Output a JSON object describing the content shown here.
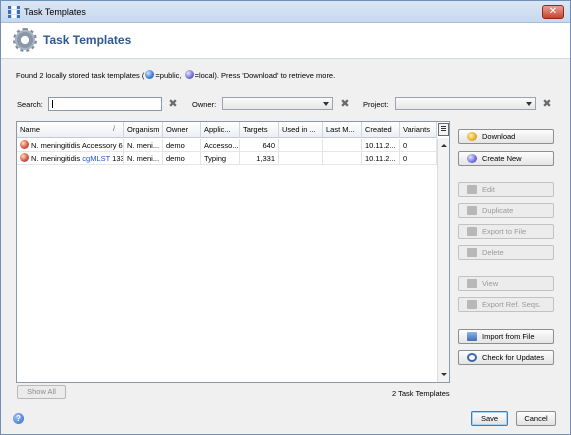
{
  "window": {
    "title": "Task Templates",
    "close_glyph": "✕"
  },
  "header": {
    "title": "Task Templates",
    "icon": "gear-icon"
  },
  "info": {
    "prefix": "Found 2 locally stored task templates (",
    "public_label": "=public, ",
    "local_label": "=local). Press 'Download' to retrieve more."
  },
  "filters": {
    "search_label": "Search:",
    "search_value": "",
    "owner_label": "Owner:",
    "owner_value": "",
    "project_label": "Project:",
    "project_value": "",
    "clear_glyph": "✖"
  },
  "table": {
    "columns": [
      "Name",
      "Organism",
      "Owner",
      "Applic...",
      "Targets",
      "Used in ...",
      "Last M...",
      "Created",
      "Variants"
    ],
    "sort_indicator": "/",
    "rows": [
      {
        "name": "N. meningitidis Accessory 6",
        "name_link": "",
        "name_suffix": "",
        "organism": "N. meni...",
        "owner": "demo",
        "application": "Accesso...",
        "targets": "640",
        "used_in": "",
        "last_modified": "",
        "created": "10.11.2...",
        "variants": "0"
      },
      {
        "name": "N. meningitidis ",
        "name_link": "cgMLST",
        "name_suffix": " 133",
        "organism": "N. meni...",
        "owner": "demo",
        "application": "Typing",
        "targets": "1,331",
        "used_in": "",
        "last_modified": "",
        "created": "10.11.2...",
        "variants": "0"
      }
    ],
    "count_label": "2 Task Templates",
    "show_all_label": "Show All"
  },
  "side_buttons": [
    {
      "label": "Download",
      "icon": "download-icon",
      "enabled": true
    },
    {
      "label": "Create New",
      "icon": "create-new-icon",
      "enabled": true
    },
    {
      "label": "Edit",
      "icon": "edit-icon",
      "enabled": false
    },
    {
      "label": "Duplicate",
      "icon": "duplicate-icon",
      "enabled": false
    },
    {
      "label": "Export to File",
      "icon": "export-icon",
      "enabled": false
    },
    {
      "label": "Delete",
      "icon": "delete-icon",
      "enabled": false
    },
    {
      "label": "View",
      "icon": "view-icon",
      "enabled": false
    },
    {
      "label": "Export Ref. Seqs.",
      "icon": "export-ref-icon",
      "enabled": false
    },
    {
      "label": "Import from File",
      "icon": "import-icon",
      "enabled": true
    },
    {
      "label": "Check for Updates",
      "icon": "check-updates-icon",
      "enabled": true
    }
  ],
  "footer": {
    "help_glyph": "?",
    "save_label": "Save",
    "cancel_label": "Cancel"
  },
  "colors": {
    "header_title": "#2e5893",
    "link": "#1f4fd1",
    "accent": "#3c7fb1"
  }
}
